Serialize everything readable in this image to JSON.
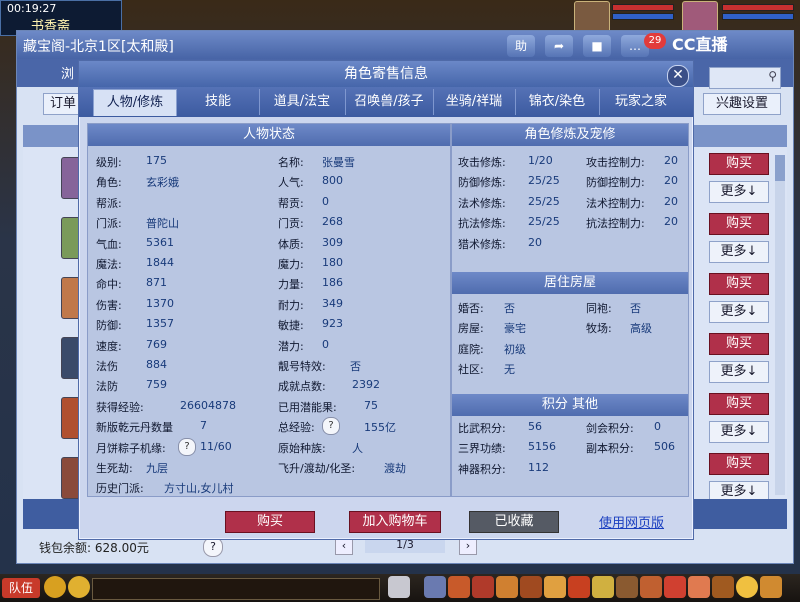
{
  "clock": {
    "time": "00:19:27",
    "place": "书香斋"
  },
  "shop": {
    "title": "藏宝阁-北京1区[太和殿]",
    "browse_tab": "浏",
    "order_label": "订单",
    "interest_label": "兴趣设置",
    "help_label": "助",
    "badge_count": "29",
    "cc_logo": "CC直播",
    "wallet": "钱包余额: 628.00元",
    "page": "1/3",
    "list_buy": "购买",
    "list_more": "更多↓"
  },
  "dialog": {
    "title": "角色寄售信息",
    "close_glyph": "✕",
    "tabs": [
      "人物/修炼",
      "技能",
      "道具/法宝",
      "召唤兽/孩子",
      "坐骑/祥瑞",
      "锦衣/染色",
      "玩家之家"
    ],
    "active_tab": 0,
    "left_title": "人物状态",
    "right_title": "角色修炼及宠修",
    "house_title": "居住房屋",
    "score_title": "积分 其他",
    "buttons": {
      "buy": "购买",
      "cart": "加入购物车",
      "fav": "已收藏",
      "web": "使用网页版"
    }
  },
  "status_left": [
    {
      "label": "级别:",
      "value": "175"
    },
    {
      "label": "角色:",
      "value": "玄彩娥"
    },
    {
      "label": "帮派:",
      "value": ""
    },
    {
      "label": "门派:",
      "value": "普陀山"
    },
    {
      "label": "气血:",
      "value": "5361"
    },
    {
      "label": "魔法:",
      "value": "1844"
    },
    {
      "label": "命中:",
      "value": "871"
    },
    {
      "label": "伤害:",
      "value": "1370"
    },
    {
      "label": "防御:",
      "value": "1357"
    },
    {
      "label": "速度:",
      "value": "769"
    },
    {
      "label": "法伤",
      "value": "884"
    },
    {
      "label": "法防",
      "value": "759"
    },
    {
      "label": "获得经验:",
      "value": "26604878"
    },
    {
      "label": "新版乾元丹数量",
      "value": "7"
    },
    {
      "label": "月饼粽子机缘:",
      "value": "11/60"
    },
    {
      "label": "生死劫:",
      "value": "九层"
    },
    {
      "label": "历史门派:",
      "value": "方寸山,女儿村"
    }
  ],
  "status_mid": [
    {
      "label": "名称:",
      "value": "张曼雪"
    },
    {
      "label": "人气:",
      "value": "800"
    },
    {
      "label": "帮贡:",
      "value": "0"
    },
    {
      "label": "门贡:",
      "value": "268"
    },
    {
      "label": "体质:",
      "value": "309"
    },
    {
      "label": "魔力:",
      "value": "180"
    },
    {
      "label": "力量:",
      "value": "186"
    },
    {
      "label": "耐力:",
      "value": "349"
    },
    {
      "label": "敏捷:",
      "value": "923"
    },
    {
      "label": "潜力:",
      "value": "0"
    },
    {
      "label": "靓号特效:",
      "value": "否"
    },
    {
      "label": "成就点数:",
      "value": "2392"
    },
    {
      "label": "已用潜能果:",
      "value": "75"
    },
    {
      "label": "总经验:",
      "value": "155亿"
    },
    {
      "label": "原始种族:",
      "value": "人"
    },
    {
      "label": "飞升/渡劫/化圣:",
      "value": "渡劫"
    }
  ],
  "cultivation": [
    {
      "label": "攻击修炼:",
      "value": "1/20",
      "label2": "攻击控制力:",
      "value2": "20"
    },
    {
      "label": "防御修炼:",
      "value": "25/25",
      "label2": "防御控制力:",
      "value2": "20"
    },
    {
      "label": "法术修炼:",
      "value": "25/25",
      "label2": "法术控制力:",
      "value2": "20"
    },
    {
      "label": "抗法修炼:",
      "value": "25/25",
      "label2": "抗法控制力:",
      "value2": "20"
    },
    {
      "label": "猎术修炼:",
      "value": "20",
      "label2": "",
      "value2": ""
    }
  ],
  "house": [
    {
      "label": "婚否:",
      "value": "否",
      "label2": "同袍:",
      "value2": "否"
    },
    {
      "label": "房屋:",
      "value": "豪宅",
      "label2": "牧场:",
      "value2": "高级"
    },
    {
      "label": "庭院:",
      "value": "初级",
      "label2": "",
      "value2": ""
    },
    {
      "label": "社区:",
      "value": "无",
      "label2": "",
      "value2": ""
    }
  ],
  "scores": [
    {
      "label": "比武积分:",
      "value": "56",
      "label2": "剑会积分:",
      "value2": "0"
    },
    {
      "label": "三界功绩:",
      "value": "5156",
      "label2": "副本积分:",
      "value2": "506"
    },
    {
      "label": "神器积分:",
      "value": "112",
      "label2": "",
      "value2": ""
    }
  ],
  "bottom": {
    "team": "队伍"
  },
  "colors": {
    "accent": "#4a66a8",
    "buy": "#b0304a",
    "value_text": "#183a7a"
  }
}
